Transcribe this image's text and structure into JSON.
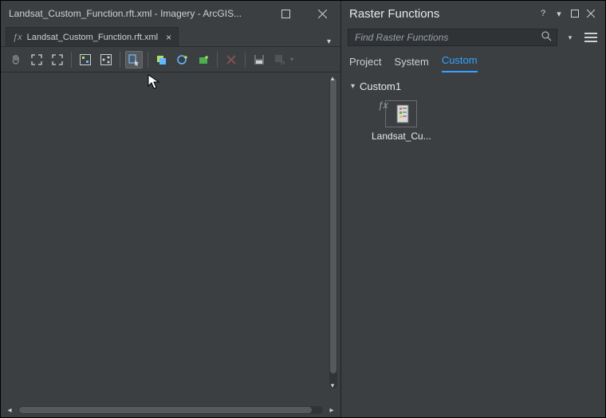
{
  "window": {
    "title": "Landsat_Custom_Function.rft.xml - Imagery - ArcGIS..."
  },
  "document_tab": {
    "label": "Landsat_Custom_Function.rft.xml"
  },
  "right_panel": {
    "title": "Raster Functions",
    "search_placeholder": "Find Raster Functions",
    "help_symbol": "?",
    "tabs": {
      "project": "Project",
      "system": "System",
      "custom": "Custom"
    },
    "tree": {
      "root_label": "Custom1",
      "item_label": "Landsat_Cu..."
    }
  }
}
